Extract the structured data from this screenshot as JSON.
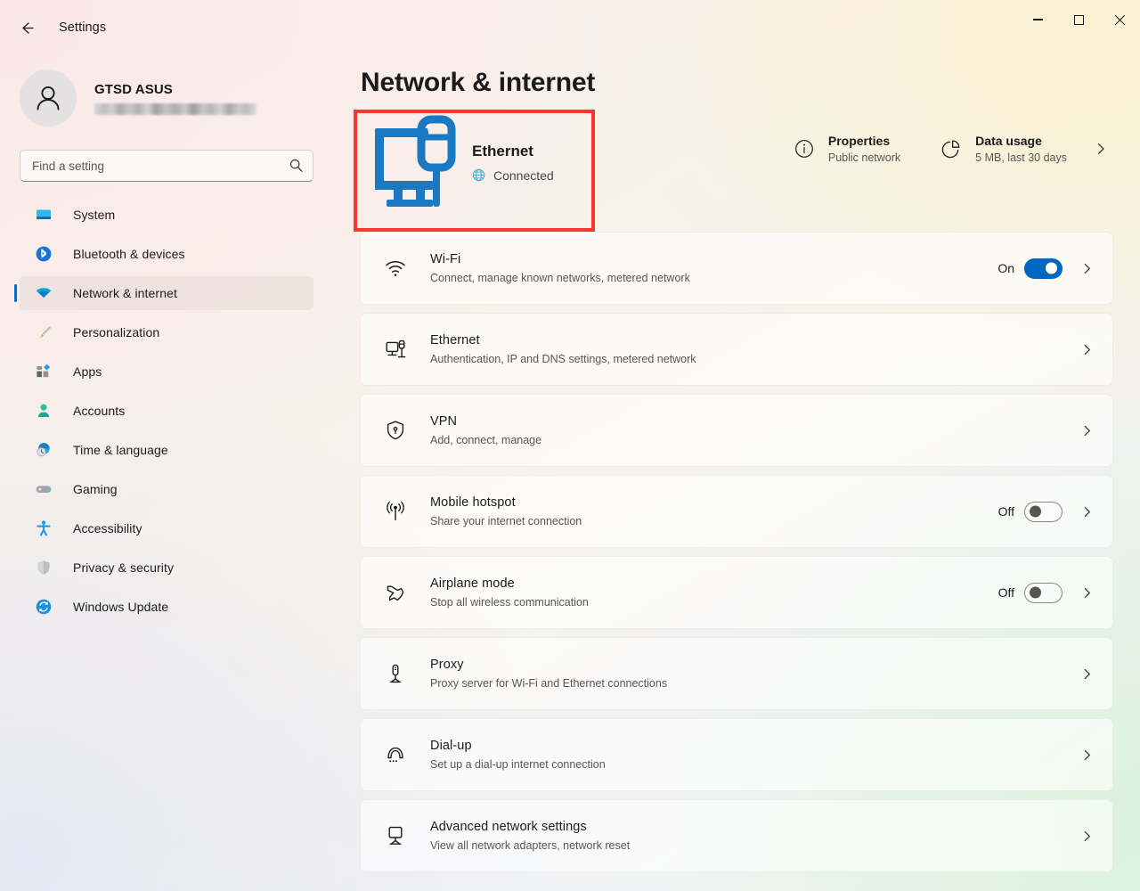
{
  "titlebar": {
    "back_icon": "back-arrow-icon",
    "title": "Settings",
    "minimize": "minimize-icon",
    "maximize": "maximize-icon",
    "close": "close-icon"
  },
  "sidebar": {
    "profile": {
      "name": "GTSD ASUS",
      "email_redacted": true
    },
    "search": {
      "placeholder": "Find a setting",
      "value": "",
      "icon": "search-icon"
    },
    "items": [
      {
        "label": "System",
        "icon": "monitor-icon",
        "active": false
      },
      {
        "label": "Bluetooth & devices",
        "icon": "bluetooth-icon",
        "active": false
      },
      {
        "label": "Network & internet",
        "icon": "wifi-icon",
        "active": true
      },
      {
        "label": "Personalization",
        "icon": "paintbrush-icon",
        "active": false
      },
      {
        "label": "Apps",
        "icon": "apps-icon",
        "active": false
      },
      {
        "label": "Accounts",
        "icon": "person-icon",
        "active": false
      },
      {
        "label": "Time & language",
        "icon": "clock-globe-icon",
        "active": false
      },
      {
        "label": "Gaming",
        "icon": "gamepad-icon",
        "active": false
      },
      {
        "label": "Accessibility",
        "icon": "accessibility-icon",
        "active": false
      },
      {
        "label": "Privacy & security",
        "icon": "shield-icon",
        "active": false
      },
      {
        "label": "Windows Update",
        "icon": "refresh-icon",
        "active": false
      }
    ]
  },
  "main": {
    "page_title": "Network & internet",
    "hero": {
      "icon": "ethernet-pc-icon",
      "name": "Ethernet",
      "status": "Connected",
      "status_icon": "globe-icon",
      "highlighted": true,
      "highlight_color": "#f8382e",
      "actions": [
        {
          "icon": "info-icon",
          "title": "Properties",
          "sub": "Public network"
        },
        {
          "icon": "pie-chart-icon",
          "title": "Data usage",
          "sub": "5 MB, last 30 days"
        }
      ],
      "chevron": "chevron-right-icon"
    },
    "settings_rows": [
      {
        "icon": "wifi-icon",
        "title": "Wi-Fi",
        "sub": "Connect, manage known networks, metered network",
        "toggle": {
          "state": "On",
          "on": true
        },
        "chevron": "chevron-right-icon"
      },
      {
        "icon": "ethernet-icon",
        "title": "Ethernet",
        "sub": "Authentication, IP and DNS settings, metered network",
        "toggle": null,
        "chevron": "chevron-right-icon"
      },
      {
        "icon": "vpn-shield-icon",
        "title": "VPN",
        "sub": "Add, connect, manage",
        "toggle": null,
        "chevron": "chevron-right-icon"
      },
      {
        "icon": "hotspot-icon",
        "title": "Mobile hotspot",
        "sub": "Share your internet connection",
        "toggle": {
          "state": "Off",
          "on": false
        },
        "chevron": "chevron-right-icon"
      },
      {
        "icon": "airplane-icon",
        "title": "Airplane mode",
        "sub": "Stop all wireless communication",
        "toggle": {
          "state": "Off",
          "on": false
        },
        "chevron": "chevron-right-icon"
      },
      {
        "icon": "proxy-icon",
        "title": "Proxy",
        "sub": "Proxy server for Wi-Fi and Ethernet connections",
        "toggle": null,
        "chevron": "chevron-right-icon"
      },
      {
        "icon": "dialup-icon",
        "title": "Dial-up",
        "sub": "Set up a dial-up internet connection",
        "toggle": null,
        "chevron": "chevron-right-icon"
      },
      {
        "icon": "advanced-network-icon",
        "title": "Advanced network settings",
        "sub": "View all network adapters, network reset",
        "toggle": null,
        "chevron": "chevron-right-icon"
      }
    ]
  },
  "colors": {
    "accent": "#0067c0",
    "nav_indicator": "#0f6cbd",
    "highlight": "#f8382e",
    "ethernet_blue": "#1b79c4"
  }
}
